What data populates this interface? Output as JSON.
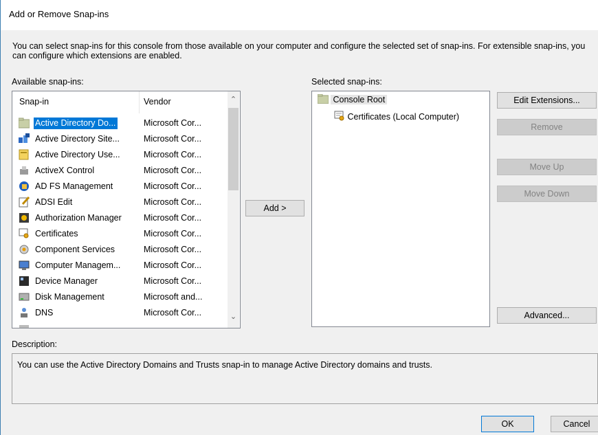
{
  "window": {
    "title": "Add or Remove Snap-ins",
    "intro": "You can select snap-ins for this console from those available on your computer and configure the selected set of snap-ins. For extensible snap-ins, you can configure which extensions are enabled."
  },
  "available": {
    "label": "Available snap-ins:",
    "col_snapin": "Snap-in",
    "col_vendor": "Vendor",
    "items": [
      {
        "name": "Active Directory Do...",
        "vendor": "Microsoft Cor...",
        "icon": "folder-icon",
        "selected": true
      },
      {
        "name": "Active Directory Site...",
        "vendor": "Microsoft Cor...",
        "icon": "ad-sites-icon"
      },
      {
        "name": "Active Directory Use...",
        "vendor": "Microsoft Cor...",
        "icon": "ad-users-icon"
      },
      {
        "name": "ActiveX Control",
        "vendor": "Microsoft Cor...",
        "icon": "activex-icon"
      },
      {
        "name": "AD FS Management",
        "vendor": "Microsoft Cor...",
        "icon": "adfs-icon"
      },
      {
        "name": "ADSI Edit",
        "vendor": "Microsoft Cor...",
        "icon": "adsi-edit-icon"
      },
      {
        "name": "Authorization Manager",
        "vendor": "Microsoft Cor...",
        "icon": "authorization-icon"
      },
      {
        "name": "Certificates",
        "vendor": "Microsoft Cor...",
        "icon": "certificate-icon"
      },
      {
        "name": "Component Services",
        "vendor": "Microsoft Cor...",
        "icon": "component-services-icon"
      },
      {
        "name": "Computer Managem...",
        "vendor": "Microsoft Cor...",
        "icon": "computer-management-icon"
      },
      {
        "name": "Device Manager",
        "vendor": "Microsoft Cor...",
        "icon": "device-manager-icon"
      },
      {
        "name": "Disk Management",
        "vendor": "Microsoft and...",
        "icon": "disk-management-icon"
      },
      {
        "name": "DNS",
        "vendor": "Microsoft Cor...",
        "icon": "dns-icon"
      },
      {
        "name": "",
        "vendor": "",
        "icon": "event-viewer-icon"
      }
    ]
  },
  "add_button": "Add >",
  "selected": {
    "label": "Selected snap-ins:",
    "root": "Console Root",
    "child": "Certificates (Local Computer)"
  },
  "buttons": {
    "edit_extensions": "Edit Extensions...",
    "remove": "Remove",
    "move_up": "Move Up",
    "move_down": "Move Down",
    "advanced": "Advanced...",
    "ok": "OK",
    "cancel": "Cancel"
  },
  "description": {
    "label": "Description:",
    "text": "You can use the Active Directory Domains and Trusts snap-in to manage Active Directory domains and trusts."
  },
  "colors": {
    "selection": "#0078d7",
    "dialog_bg": "#f0f0f0",
    "default_button_border": "#0078d7"
  }
}
